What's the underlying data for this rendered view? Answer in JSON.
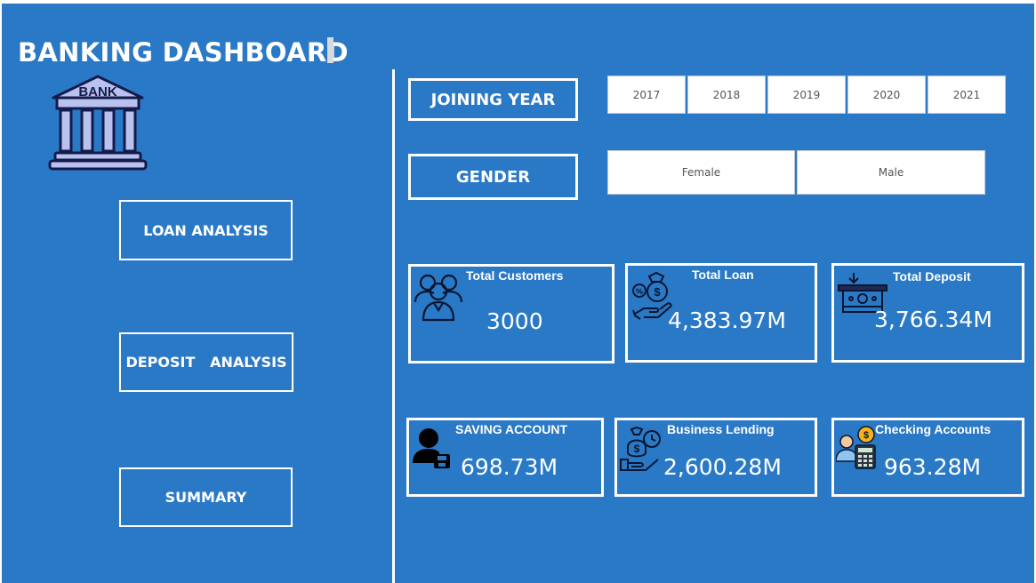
{
  "dashboard": {
    "title": "BANKING DASHBOARD",
    "logo_text": "BANK"
  },
  "nav": {
    "loan_label": "LOAN ANALYSIS",
    "deposit_label": "DEPOSIT   ANALYSIS",
    "summary_label": "SUMMARY"
  },
  "filters": {
    "joining_year_label": "JOINING YEAR",
    "years": [
      "2017",
      "2018",
      "2019",
      "2020",
      "2021"
    ],
    "gender_label": "GENDER",
    "genders": [
      "Female",
      "Male"
    ]
  },
  "kpis": {
    "total_customers": {
      "title": "Total Customers",
      "value": "3000"
    },
    "total_loan": {
      "title": "Total Loan",
      "value": "4,383.97M"
    },
    "total_deposit": {
      "title": "Total Deposit",
      "value": "3,766.34M"
    },
    "saving_account": {
      "title": "SAVING ACCOUNT",
      "value": "698.73M"
    },
    "business_lending": {
      "title": "Business Lending",
      "value": "2,600.28M"
    },
    "checking_accounts": {
      "title": "Checking Accounts",
      "value": "963.28M"
    }
  },
  "colors": {
    "background": "#2a79c6",
    "foreground": "#ffffff",
    "slicer_background": "#ffffff"
  }
}
